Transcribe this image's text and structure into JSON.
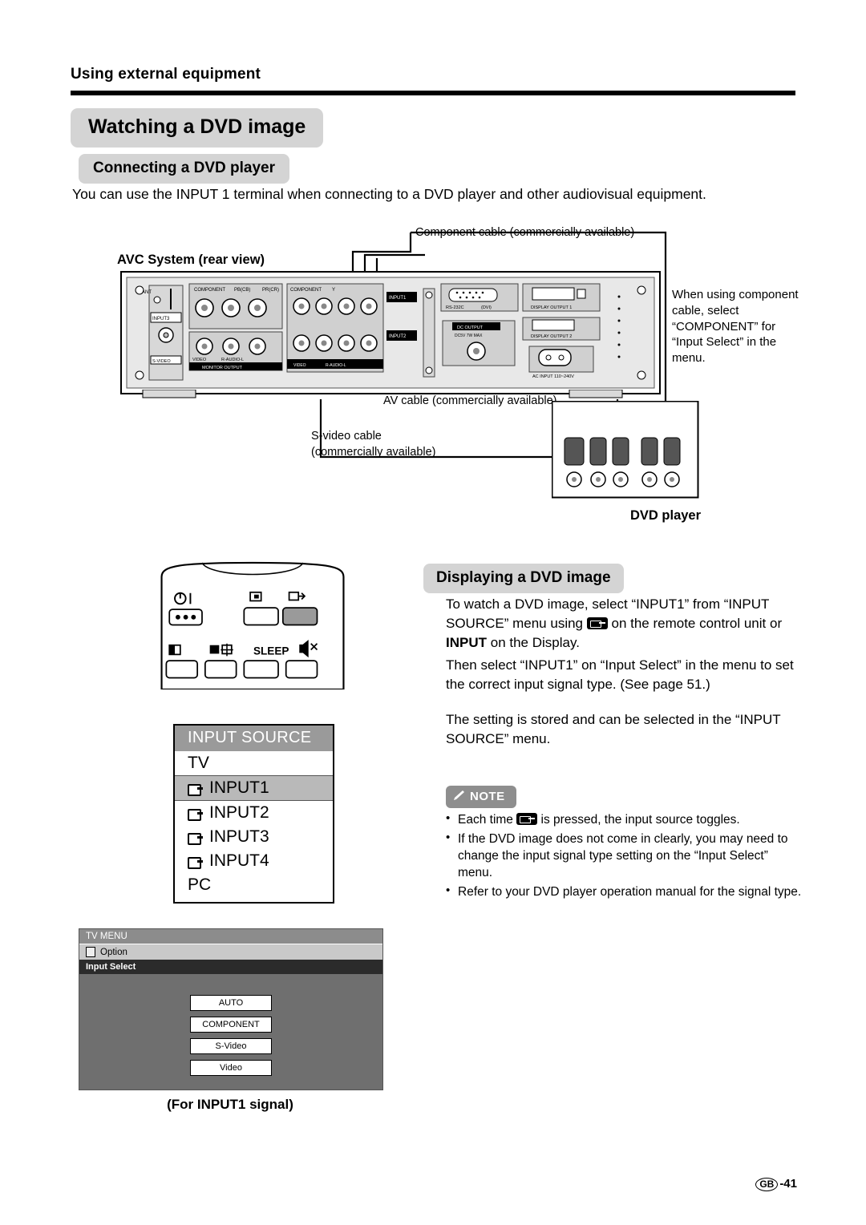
{
  "header": {
    "section": "Using external equipment",
    "title": "Watching a DVD image",
    "subtitle": "Connecting a DVD player",
    "intro": "You can use the INPUT 1 terminal when connecting to a DVD player and other audiovisual equipment."
  },
  "diagram": {
    "avc_label": "AVC System (rear view)",
    "component_cable": "Component cable (commercially available)",
    "av_cable": "AV cable (commercially available)",
    "svideo_cable_line1": "S-video cable",
    "svideo_cable_line2": "(commercially available)",
    "dvd_player": "DVD player",
    "note_right": "When using component cable, select “COMPONENT” for “Input Select” in the menu.",
    "panel": {
      "component_y": "COMPONENT",
      "y": "Y",
      "pb": "PB(CB)",
      "pr": "PR(CR)",
      "component2": "COMPONENT",
      "ant": "ANT",
      "input3": "INPUT3",
      "svideo": "S-VIDEO",
      "video": "VIDEO",
      "audio": "R-AUDIO-L",
      "monitor_output": "MONITOR OUTPUT",
      "input1": "INPUT1",
      "input2": "INPUT2",
      "rs232c": "RS-232C",
      "dvi": "(DVI)",
      "display_output1": "DISPLAY OUTPUT 1",
      "display_output2": "DISPLAY OUTPUT 2",
      "dc_output": "DC OUTPUT",
      "dc_rating": "DC5V  7W MAX",
      "ac_input": "AC INPUT 110~240V"
    }
  },
  "osd_input_source": {
    "title": "INPUT SOURCE",
    "items": [
      {
        "label": "TV",
        "icon": false,
        "selected": false
      },
      {
        "label": "INPUT1",
        "icon": true,
        "selected": true
      },
      {
        "label": "INPUT2",
        "icon": true,
        "selected": false
      },
      {
        "label": "INPUT3",
        "icon": true,
        "selected": false
      },
      {
        "label": "INPUT4",
        "icon": true,
        "selected": false
      },
      {
        "label": "PC",
        "icon": false,
        "selected": false
      }
    ]
  },
  "tv_menu": {
    "title": "TV MENU",
    "option": "Option",
    "input_select": "Input Select",
    "items": [
      "AUTO",
      "COMPONENT",
      "S-Video",
      "Video"
    ],
    "caption": "(For INPUT1 signal)"
  },
  "remote": {
    "sleep_label": "SLEEP"
  },
  "right": {
    "heading": "Displaying a DVD image",
    "p1_a": "To watch a DVD image, select “INPUT1” from “INPUT SOURCE” menu using",
    "p1_b": "on the remote control unit or",
    "p1_bold": "INPUT",
    "p1_c": "on the Display.",
    "p2": "Then select “INPUT1” on “Input Select” in the menu to set the correct input signal type. (See page 51.)",
    "p3": "The setting is stored and can be selected in the “INPUT SOURCE” menu.",
    "note_label": "NOTE",
    "notes": [
      "Each time  is pressed, the input source toggles.",
      "If the DVD image does not come in clearly, you may need to change the input signal type setting on the “Input Select” menu.",
      "Refer to your DVD player operation manual for the signal type."
    ],
    "note1_a": "Each time",
    "note1_b": "is pressed, the input source toggles."
  },
  "footer": {
    "region": "GB",
    "page": "-41"
  }
}
